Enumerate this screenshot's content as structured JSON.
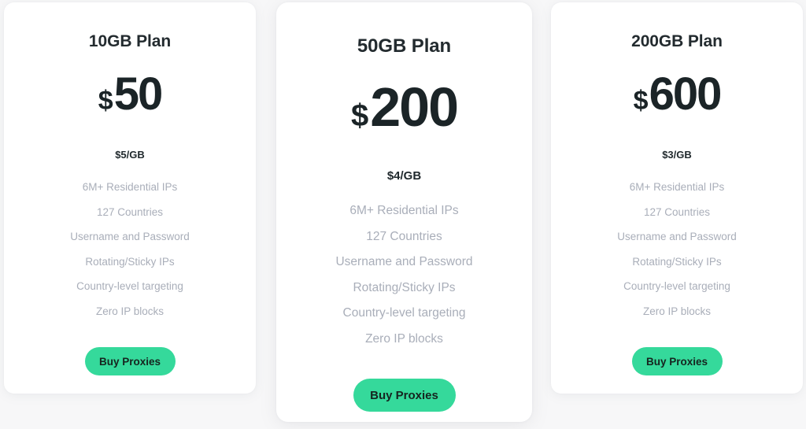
{
  "theme": {
    "page_background": "#f7f7f8",
    "card_background": "#ffffff",
    "accent_green": "#35d99b",
    "title_color": "#232b2f",
    "price_color": "#1b2427",
    "feature_color": "#a9aeb9"
  },
  "pricing": {
    "plans": [
      {
        "title": "10GB Plan",
        "currency": "$",
        "price": "50",
        "rate": "$5/GB",
        "featured": false,
        "features": [
          "6M+ Residential IPs",
          "127 Countries",
          "Username and Password",
          "Rotating/Sticky IPs",
          "Country-level targeting",
          "Zero IP blocks"
        ],
        "cta_label": "Buy Proxies"
      },
      {
        "title": "50GB Plan",
        "currency": "$",
        "price": "200",
        "rate": "$4/GB",
        "featured": true,
        "features": [
          "6M+ Residential IPs",
          "127 Countries",
          "Username and Password",
          "Rotating/Sticky IPs",
          "Country-level targeting",
          "Zero IP blocks"
        ],
        "cta_label": "Buy Proxies"
      },
      {
        "title": "200GB Plan",
        "currency": "$",
        "price": "600",
        "rate": "$3/GB",
        "featured": false,
        "features": [
          "6M+ Residential IPs",
          "127 Countries",
          "Username and Password",
          "Rotating/Sticky IPs",
          "Country-level targeting",
          "Zero IP blocks"
        ],
        "cta_label": "Buy Proxies"
      }
    ]
  }
}
